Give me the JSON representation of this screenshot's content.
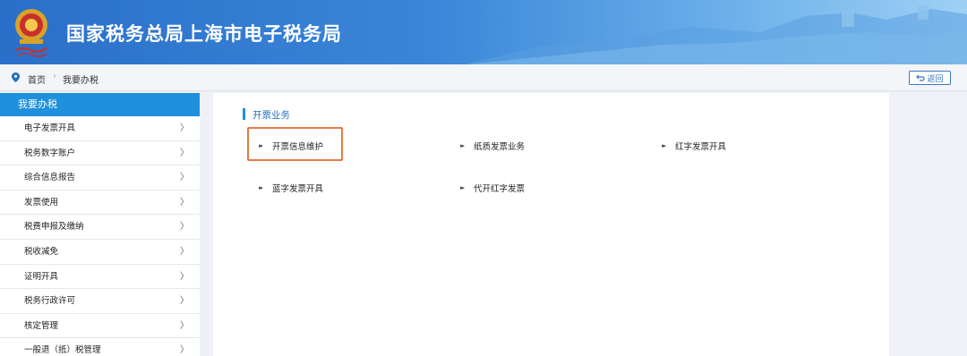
{
  "header": {
    "title": "国家税务总局上海市电子税务局"
  },
  "breadcrumb": {
    "home": "首页",
    "current": "我要办税"
  },
  "back_button": {
    "label": "返回"
  },
  "sidebar": {
    "title": "我要办税",
    "items": [
      {
        "label": "电子发票开具"
      },
      {
        "label": "税务数字账户"
      },
      {
        "label": "综合信息报告"
      },
      {
        "label": "发票使用"
      },
      {
        "label": "税费申报及缴纳"
      },
      {
        "label": "税收减免"
      },
      {
        "label": "证明开具"
      },
      {
        "label": "税务行政许可"
      },
      {
        "label": "核定管理"
      },
      {
        "label": "一般退（抵）税管理"
      }
    ]
  },
  "main": {
    "section_title": "开票业务",
    "items": [
      {
        "label": "开票信息维护"
      },
      {
        "label": "纸质发票业务"
      },
      {
        "label": "红字发票开具"
      },
      {
        "label": "蓝字发票开具"
      },
      {
        "label": "代开红字发票"
      }
    ]
  },
  "colors": {
    "accent": "#1e90dc",
    "highlight_border": "#e27b47",
    "header_start": "#2a6fc9"
  }
}
